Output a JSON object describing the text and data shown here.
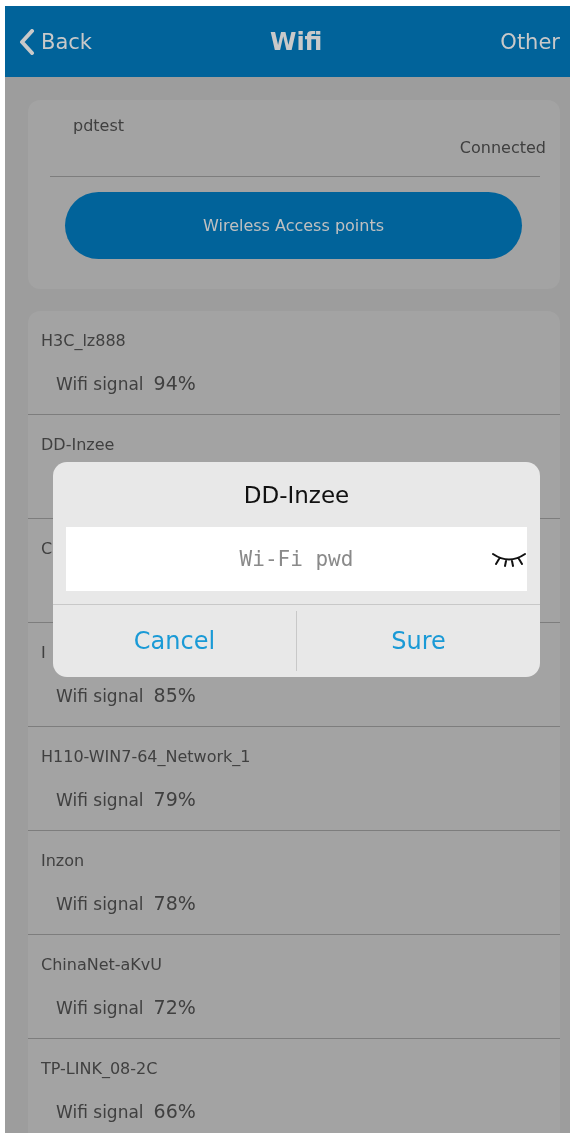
{
  "header": {
    "back": "Back",
    "title": "Wifi",
    "other": "Other"
  },
  "current": {
    "name": "pdtest",
    "status": "Connected",
    "button": "Wireless Access points"
  },
  "networks": [
    {
      "name": "H3C_lz888",
      "signal_label": "Wifi signal",
      "signal": "94%"
    },
    {
      "name": "DD-Inzee"
    },
    {
      "name": "C"
    },
    {
      "name": "I",
      "signal_label": "Wifi signal",
      "signal": "85%"
    },
    {
      "name": "H110-WIN7-64_Network_1",
      "signal_label": "Wifi signal",
      "signal": "79%"
    },
    {
      "name": "Inzon",
      "signal_label": "Wifi signal",
      "signal": "78%"
    },
    {
      "name": "ChinaNet-aKvU",
      "signal_label": "Wifi signal",
      "signal": "72%"
    },
    {
      "name": "TP-LINK_08-2C",
      "signal_label": "Wifi signal",
      "signal": "66%"
    }
  ],
  "dialog": {
    "title": "DD-Inzee",
    "placeholder": "Wi-Fi pwd",
    "buttons": [
      "Cancel",
      "Sure"
    ]
  }
}
